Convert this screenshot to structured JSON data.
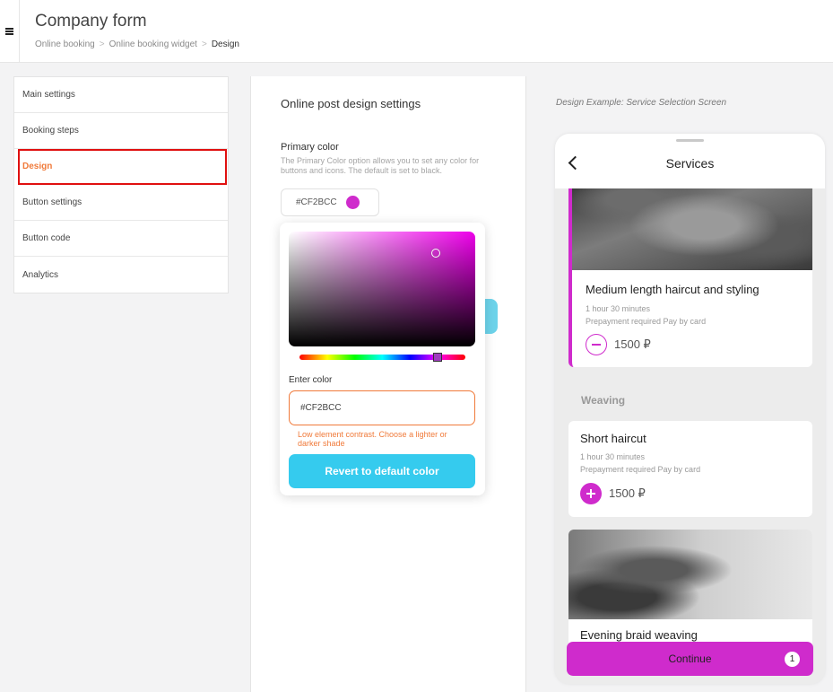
{
  "header": {
    "title": "Company form",
    "breadcrumb": [
      "Online booking",
      "Online booking widget",
      "Design"
    ],
    "separator": ">"
  },
  "sidebar": {
    "items": [
      {
        "label": "Main settings"
      },
      {
        "label": "Booking steps"
      },
      {
        "label": "Design"
      },
      {
        "label": "Button settings"
      },
      {
        "label": "Button code"
      },
      {
        "label": "Analytics"
      }
    ],
    "active": "Design"
  },
  "settings": {
    "title": "Online post design settings",
    "primary_label": "Primary color",
    "primary_desc": "The Primary Color option allows you to set any color for buttons and icons. The default is set to black.",
    "primary_value": "#CF2BCC"
  },
  "picker": {
    "enter_label": "Enter color",
    "input_value": "#CF2BCC",
    "error": "Low element contrast. Choose a lighter or darker shade",
    "revert_label": "Revert to default color"
  },
  "preview": {
    "caption": "Design Example: Service Selection Screen",
    "screen_title": "Services",
    "services": [
      {
        "title": "Medium length haircut and styling",
        "duration": "1 hour 30 minutes",
        "payment": "Prepayment required Pay by card",
        "price": "1500 ₽",
        "selected": true
      },
      {
        "title": "Short haircut",
        "duration": "1 hour 30 minutes",
        "payment": "Prepayment required Pay by card",
        "price": "1500 ₽",
        "selected": false
      },
      {
        "title": "Evening braid weaving"
      }
    ],
    "section": "Weaving",
    "continue_label": "Continue",
    "continue_count": "1"
  },
  "colors": {
    "primary": "#CF2BCC",
    "accent_orange": "#f07a3a",
    "revert_button": "#35cbee",
    "active_outline": "#e01010"
  },
  "icons": [
    "menu-icon",
    "back-chevron-icon",
    "minus-icon",
    "plus-icon"
  ]
}
